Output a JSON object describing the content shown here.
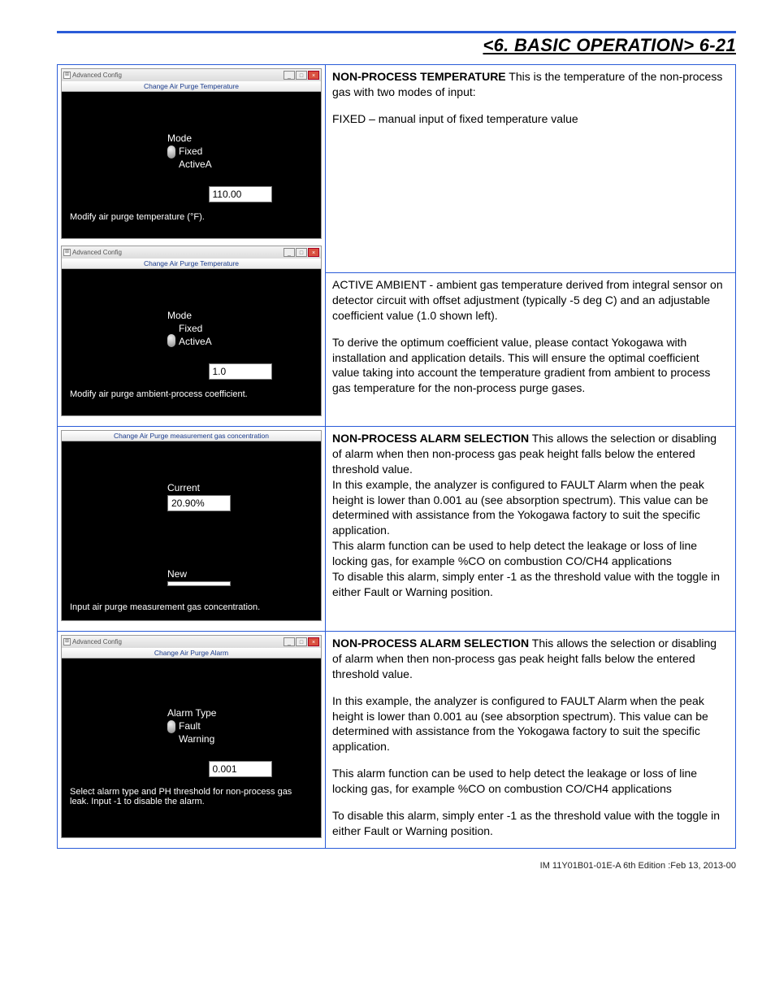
{
  "header": {
    "title": "<6. BASIC OPERATION>  6-21"
  },
  "row1": {
    "win": {
      "title": "Advanced Config",
      "subtitle": "Change Air Purge Temperature",
      "modeLabel": "Mode",
      "opt1": "Fixed",
      "opt2": "ActiveA",
      "value": "110.00",
      "caption": "Modify air purge temperature (°F)."
    },
    "desc": {
      "heading": "NON-PROCESS TEMPERATURE",
      "p1": "This is the temperature of the non-process gas with two modes of input:",
      "p2": "FIXED – manual input of fixed temperature value"
    }
  },
  "row2": {
    "win": {
      "title": "Advanced Config",
      "subtitle": "Change Air Purge Temperature",
      "modeLabel": "Mode",
      "opt1": "Fixed",
      "opt2": "ActiveA",
      "value": "1.0",
      "caption": "Modify air purge ambient-process coefficient."
    },
    "desc": {
      "p1": "ACTIVE AMBIENT - ambient gas temperature derived from integral sensor on detector circuit with offset adjustment (typically -5 deg C) and an adjustable coefficient value (1.0 shown left).",
      "p2": "To derive the optimum coefficient value, please contact Yokogawa with installation and application details. This will ensure the optimal coefficient value taking into account the temperature gradient from ambient to process gas temperature for the non-process purge gases."
    }
  },
  "row3": {
    "win": {
      "subtitle": "Change Air Purge measurement gas concentration",
      "label1": "Current",
      "value1": "20.90%",
      "label2": "New",
      "value2": "",
      "caption": "Input air purge measurement gas concentration."
    },
    "desc": {
      "heading": "NON-PROCESS ALARM SELECTION",
      "p1": "This allows the selection or disabling of alarm when then non-process gas peak height falls below the entered threshold value.",
      "p2": "In this example, the analyzer is configured to FAULT Alarm when the peak height is lower than 0.001 au (see absorption spectrum). This value can be determined with assistance from the Yokogawa factory to suit the specific application.",
      "p3": "This alarm function can be used to help detect the leakage or loss of line locking gas, for example %CO on combustion CO/CH4 applications",
      "p4": "To disable this alarm, simply enter -1 as the threshold value with the toggle in either Fault or Warning position."
    }
  },
  "row4": {
    "win": {
      "title": "Advanced Config",
      "subtitle": "Change Air Purge Alarm",
      "modeLabel": "Alarm Type",
      "opt1": "Fault",
      "opt2": "Warning",
      "value": "0.001",
      "caption": "Select alarm type and PH threshold for non-process gas leak. Input -1 to disable the alarm."
    },
    "desc": {
      "heading": "NON-PROCESS ALARM SELECTION",
      "p1": "This allows the selection or disabling of alarm when then non-process gas peak height falls below the entered threshold value.",
      "p2": "In this example, the analyzer is configured to FAULT Alarm when the peak height is lower than 0.001 au (see absorption spectrum). This value can be determined with assistance from the Yokogawa factory to suit the specific application.",
      "p3": "This alarm function can be used to help detect the leakage or loss of line locking gas, for example %CO on combustion CO/CH4 applications",
      "p4": "To disable this alarm, simply enter -1 as the threshold value with the toggle in either Fault or Warning position."
    }
  },
  "footer": "IM 11Y01B01-01E-A    6th Edition :Feb 13, 2013-00"
}
